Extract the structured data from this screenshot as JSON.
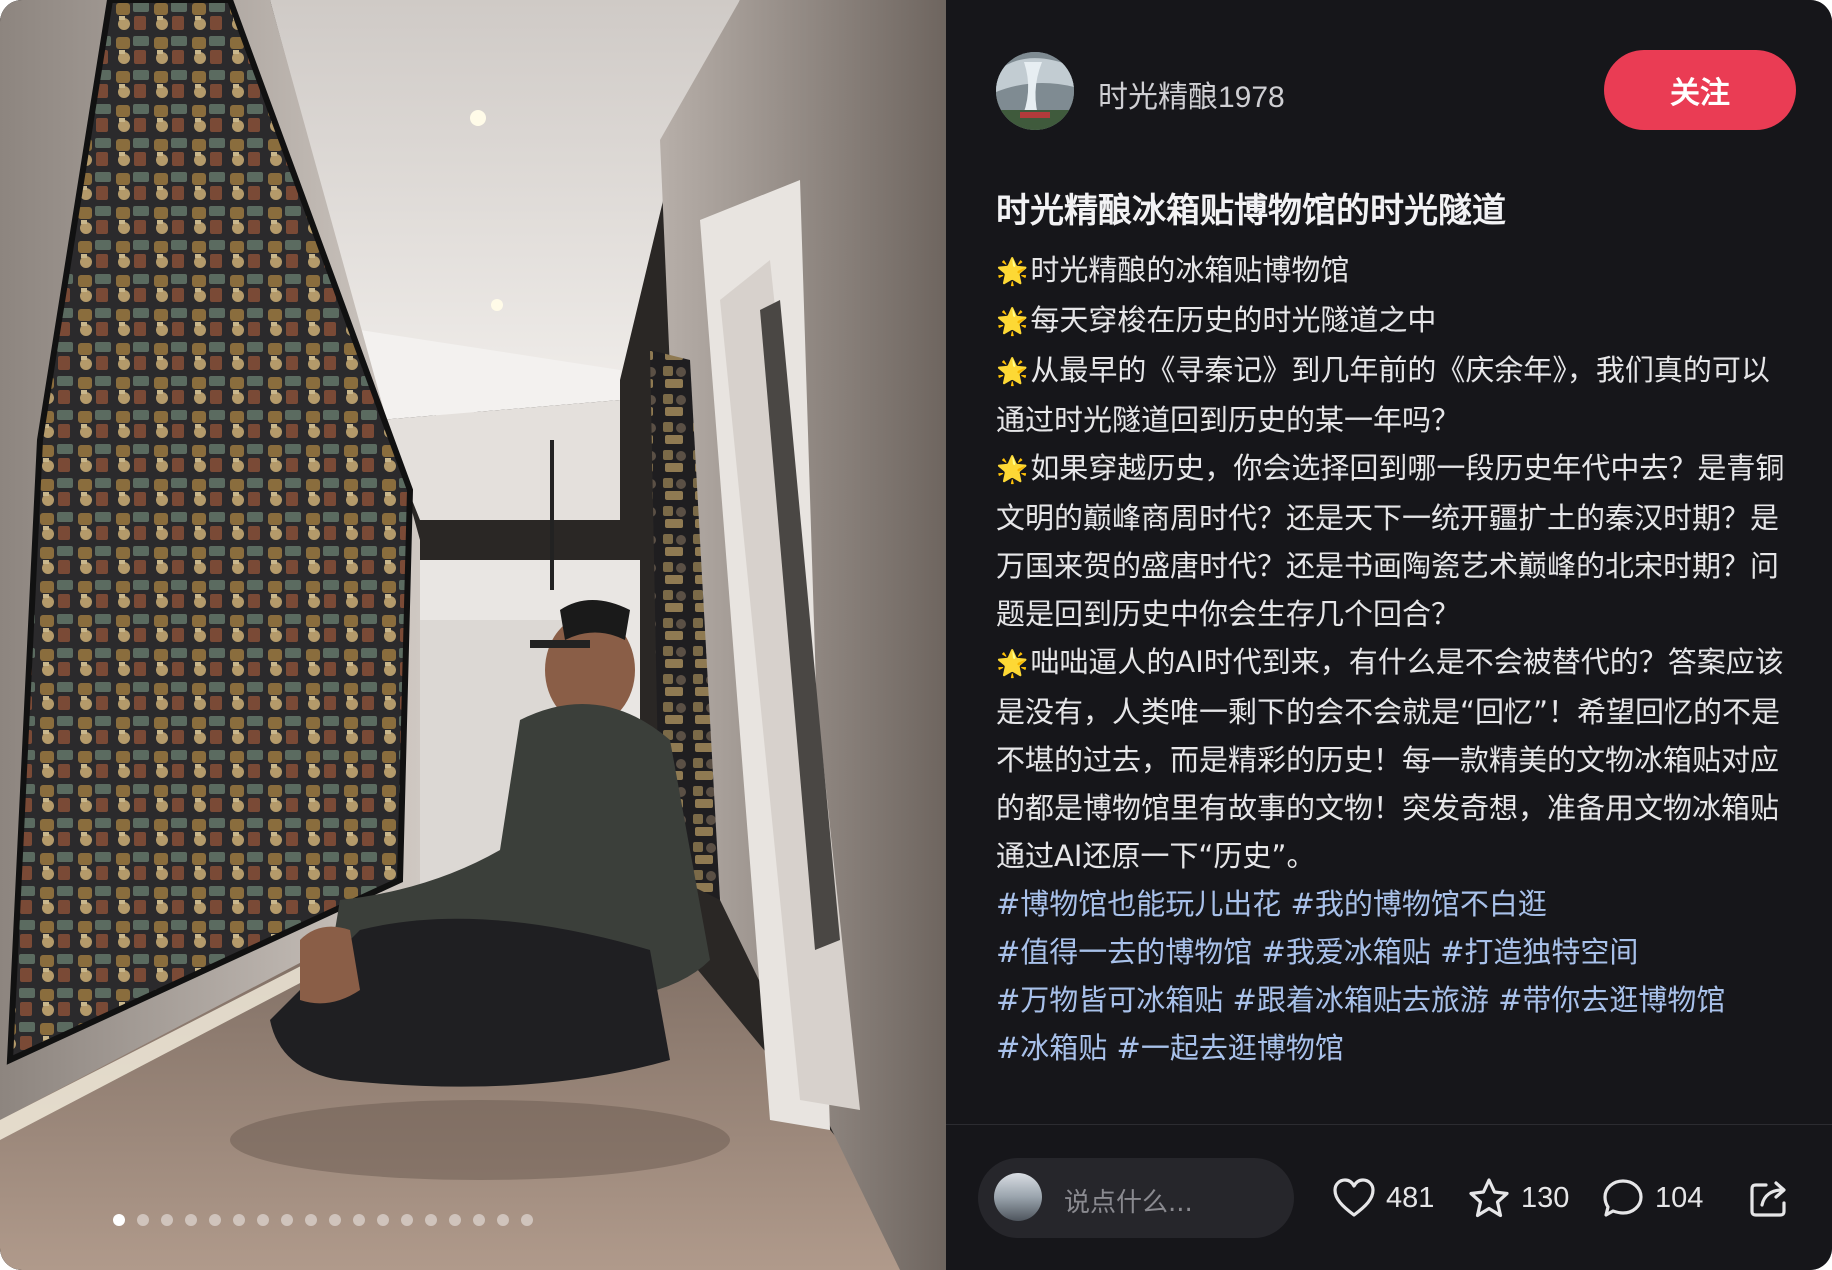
{
  "author": {
    "name": "时光精酿1978"
  },
  "follow_label": "关注",
  "post": {
    "title": "时光精酿冰箱贴博物馆的时光隧道",
    "paragraphs": [
      "时光精酿的冰箱贴博物馆",
      "每天穿梭在历史的时光隧道之中",
      "从最早的《寻秦记》到几年前的《庆余年》，我们真的可以通过时光隧道回到历史的某一年吗？",
      "如果穿越历史，你会选择回到哪一段历史年代中去？是青铜文明的巅峰商周时代？还是天下一统开疆扩土的秦汉时期？是万国来贺的盛唐时代？还是书画陶瓷艺术巅峰的北宋时期？问题是回到历史中你会生存几个回合？",
      "咄咄逼人的AI时代到来，有什么是不会被替代的？答案应该是没有，人类唯一剩下的会不会就是“回忆”！希望回忆的不是不堪的过去，而是精彩的历史！每一款精美的文物冰箱贴对应的都是博物馆里有故事的文物！突发奇想，准备用文物冰箱贴通过AI还原一下“历史”。"
    ],
    "tags": [
      "#博物馆也能玩儿出花",
      "#我的博物馆不白逛",
      "#值得一去的博物馆",
      "#我爱冰箱贴",
      "#打造独特空间",
      "#万物皆可冰箱贴",
      "#跟着冰箱贴去旅游",
      "#带你去逛博物馆",
      "#冰箱贴",
      "#一起去逛博物馆"
    ]
  },
  "image_carousel": {
    "total": 18,
    "active_index": 0
  },
  "footer": {
    "comment_placeholder": "说点什么...",
    "likes": "481",
    "favorites": "130",
    "comments": "104"
  },
  "icons": {
    "bullet": "star-icon",
    "like": "heart-icon",
    "favorite": "star-outline-icon",
    "comment": "comment-bubble-icon",
    "share": "share-icon"
  },
  "colors": {
    "background": "#16161a",
    "follow_button": "#ea3c54",
    "hashtag": "#a8c1ea",
    "bullet_star": "#f6c343"
  }
}
